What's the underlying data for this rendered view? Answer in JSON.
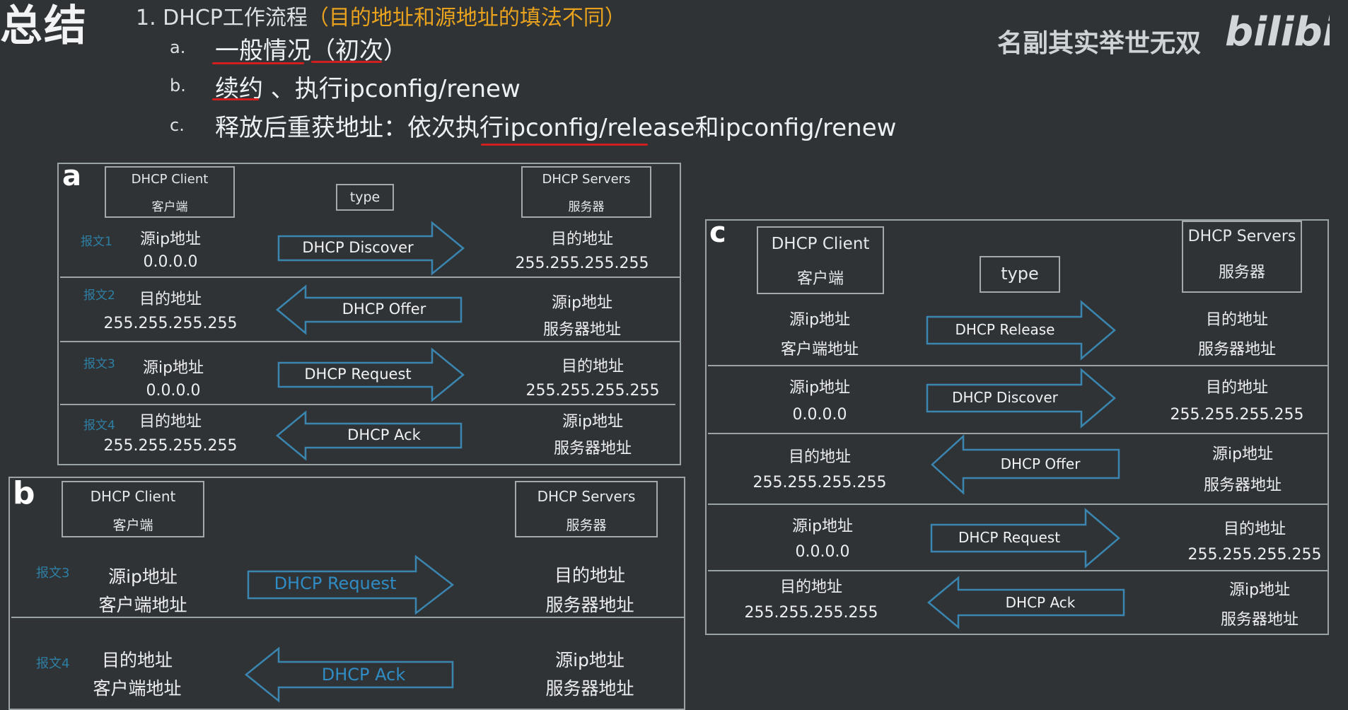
{
  "header": {
    "heading": "总结",
    "item1": {
      "num": "1.",
      "label": "DHCP工作流程",
      "highlight": "（目的地址和源地址的填法不同）"
    },
    "subitems": [
      {
        "letter": "a.",
        "text": "一般情况（初次）"
      },
      {
        "letter": "b.",
        "text": "续约 、执行ipconfig/renew"
      },
      {
        "letter": "c.",
        "text": "释放后重获地址：依次执行ipconfig/release和ipconfig/renew"
      }
    ]
  },
  "watermark": {
    "slogan": "名副其实举世无双",
    "brand": "bilibili"
  },
  "panel_a": {
    "label": "a",
    "client_box": [
      "DHCP Client",
      "客户端"
    ],
    "type_box": "type",
    "server_box": [
      "DHCP Servers",
      "服务器"
    ],
    "rows": [
      {
        "msg": "报文1",
        "left": [
          "源ip地址",
          "0.0.0.0"
        ],
        "arrow": "DHCP Discover",
        "right": [
          "目的地址",
          "255.255.255.255"
        ]
      },
      {
        "msg": "报文2",
        "left": [
          "目的地址",
          "255.255.255.255"
        ],
        "arrow": "DHCP Offer",
        "right": [
          "源ip地址",
          "服务器地址"
        ]
      },
      {
        "msg": "报文3",
        "left": [
          "源ip地址",
          "0.0.0.0"
        ],
        "arrow": "DHCP Request",
        "right": [
          "目的地址",
          "255.255.255.255"
        ]
      },
      {
        "msg": "报文4",
        "left": [
          "目的地址",
          "255.255.255.255"
        ],
        "arrow": "DHCP Ack",
        "right": [
          "源ip地址",
          "服务器地址"
        ]
      }
    ]
  },
  "panel_b": {
    "label": "b",
    "client_box": [
      "DHCP Client",
      "客户端"
    ],
    "server_box": [
      "DHCP Servers",
      "服务器"
    ],
    "rows": [
      {
        "msg": "报文3",
        "left": [
          "源ip地址",
          "客户端地址"
        ],
        "arrow": "DHCP Request",
        "right": [
          "目的地址",
          "服务器地址"
        ]
      },
      {
        "msg": "报文4",
        "left": [
          "目的地址",
          "客户端地址"
        ],
        "arrow": "DHCP Ack",
        "right": [
          "源ip地址",
          "服务器地址"
        ]
      }
    ]
  },
  "panel_c": {
    "label": "c",
    "client_box": [
      "DHCP Client",
      "客户端"
    ],
    "type_box": "type",
    "server_box": [
      "DHCP Servers",
      "服务器"
    ],
    "rows": [
      {
        "left": [
          "源ip地址",
          "客户端地址"
        ],
        "arrow": "DHCP Release",
        "right": [
          "目的地址",
          "服务器地址"
        ]
      },
      {
        "left": [
          "源ip地址",
          "0.0.0.0"
        ],
        "arrow": "DHCP Discover",
        "right": [
          "目的地址",
          "255.255.255.255"
        ]
      },
      {
        "left": [
          "目的地址",
          "255.255.255.255"
        ],
        "arrow": "DHCP Offer",
        "right": [
          "源ip地址",
          "服务器地址"
        ]
      },
      {
        "left": [
          "源ip地址",
          "0.0.0.0"
        ],
        "arrow": "DHCP Request",
        "right": [
          "目的地址",
          "255.255.255.255"
        ]
      },
      {
        "left": [
          "目的地址",
          "255.255.255.255"
        ],
        "arrow": "DHCP Ack",
        "right": [
          "源ip地址",
          "服务器地址"
        ]
      }
    ]
  },
  "colors": {
    "background": "#2f3336",
    "highlight": "#e8a21e",
    "underline": "#d11e1e",
    "arrow_stroke": "#3a86b0",
    "message_label": "#2e7fa4"
  }
}
